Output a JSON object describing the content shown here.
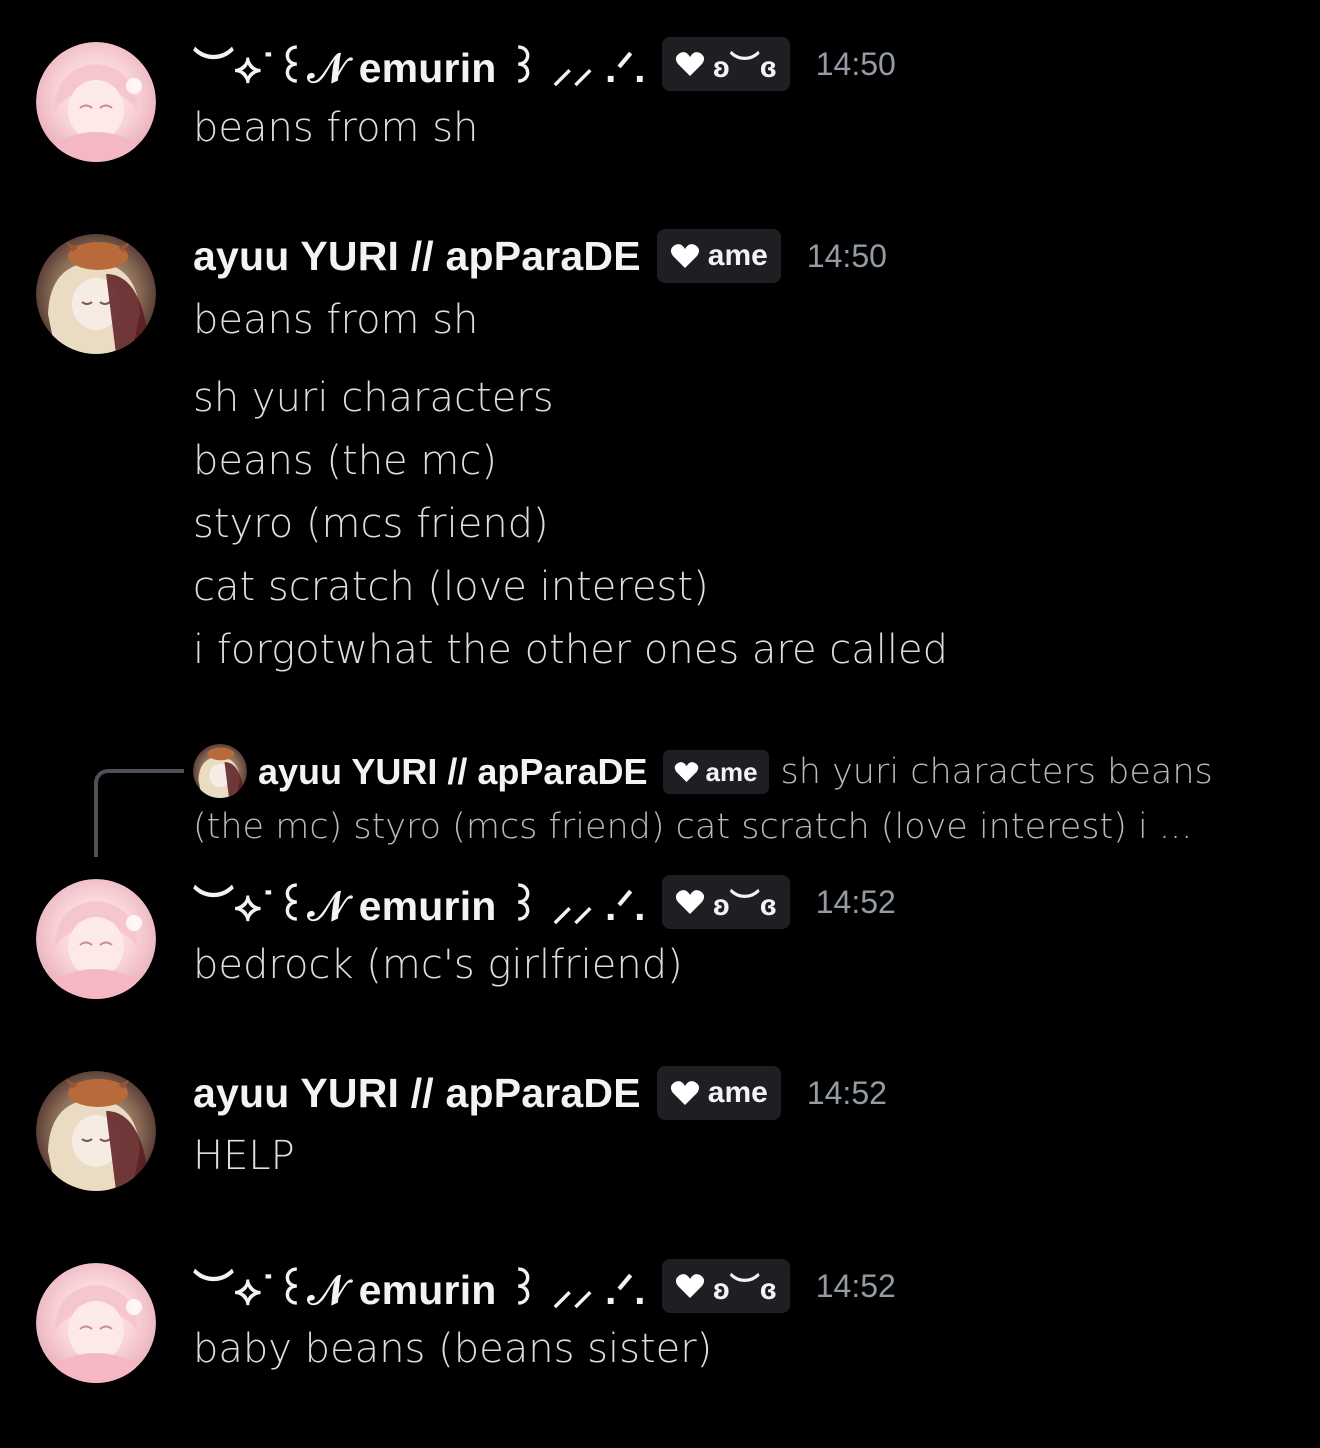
{
  "colors": {
    "background": "#000000",
    "name": "#f2f3f5",
    "text": "#dbdee1",
    "timestamp": "#949ba4",
    "tag_bg": "#1e1f22",
    "reply_text": "#b5bac1"
  },
  "users": {
    "emurin": {
      "display_name": "︶⟡˙꒰𝒩 emurin ꒱ ⸝⸝ .ᐟ.",
      "tag_text": "ʚ︶ɞ",
      "avatar_icon": "pink-anime-girl-avatar"
    },
    "ayuu": {
      "display_name": "ayuu YURI // apParaDE",
      "tag_text": "ame",
      "avatar_icon": "blonde-anime-girl-with-cat-avatar"
    }
  },
  "messages": [
    {
      "author": "︶⟡˙꒰𝒩 emurin ꒱ ⸝⸝ .ᐟ.",
      "tag": "ʚ︶ɞ",
      "time": "14:50",
      "lines": [
        "beans from sh"
      ]
    },
    {
      "author": "ayuu YURI // apParaDE",
      "tag": "ame",
      "time": "14:50",
      "lines": [
        "beans from sh",
        "sh yuri characters",
        "beans (the mc)",
        "styro (mcs friend)",
        "cat scratch (love interest)",
        "i forgotwhat the other ones are called"
      ]
    },
    {
      "reply": {
        "author": "ayuu YURI // apParaDE",
        "tag": "ame",
        "preview_line1": "sh yuri characters  beans",
        "preview_line2": "(the mc) styro (mcs friend) cat scratch (love interest) i ..."
      },
      "author": "︶⟡˙꒰𝒩 emurin ꒱ ⸝⸝ .ᐟ.",
      "tag": "ʚ︶ɞ",
      "time": "14:52",
      "lines": [
        "bedrock (mc's girlfriend)"
      ]
    },
    {
      "author": "ayuu YURI // apParaDE",
      "tag": "ame",
      "time": "14:52",
      "lines": [
        "HELP"
      ]
    },
    {
      "author": "︶⟡˙꒰𝒩 emurin ꒱ ⸝⸝ .ᐟ.",
      "tag": "ʚ︶ɞ",
      "time": "14:52",
      "lines": [
        "baby beans (beans sister)"
      ]
    }
  ]
}
